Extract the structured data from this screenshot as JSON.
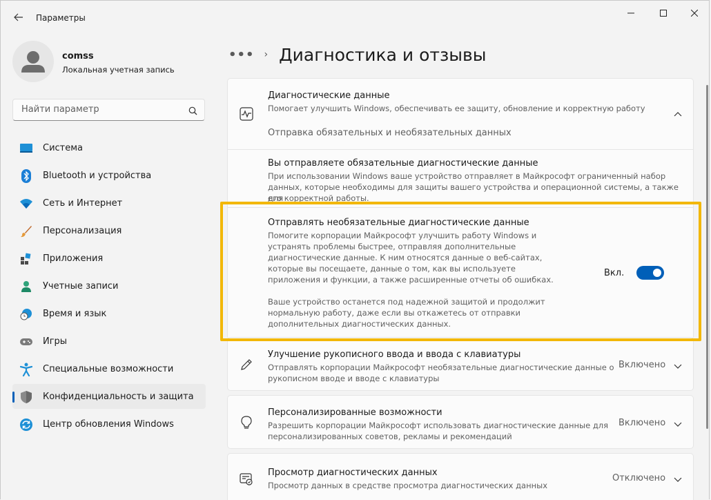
{
  "app": {
    "title": "Параметры"
  },
  "window_controls": {
    "minimize": "—",
    "maximize": "☐",
    "close": "✕"
  },
  "profile": {
    "name": "comss",
    "account_type": "Локальная учетная запись"
  },
  "search": {
    "placeholder": "Найти параметр"
  },
  "nav": {
    "items": [
      {
        "label": "Система",
        "icon": "system-icon",
        "active": false
      },
      {
        "label": "Bluetooth и устройства",
        "icon": "bluetooth-icon",
        "active": false
      },
      {
        "label": "Сеть и Интернет",
        "icon": "wifi-icon",
        "active": false
      },
      {
        "label": "Персонализация",
        "icon": "brush-icon",
        "active": false
      },
      {
        "label": "Приложения",
        "icon": "apps-icon",
        "active": false
      },
      {
        "label": "Учетные записи",
        "icon": "account-icon",
        "active": false
      },
      {
        "label": "Время и язык",
        "icon": "clock-globe-icon",
        "active": false
      },
      {
        "label": "Игры",
        "icon": "gamepad-icon",
        "active": false
      },
      {
        "label": "Специальные возможности",
        "icon": "accessibility-icon",
        "active": false
      },
      {
        "label": "Конфиденциальность и защита",
        "icon": "shield-icon",
        "active": true
      },
      {
        "label": "Центр обновления Windows",
        "icon": "update-icon",
        "active": false
      }
    ]
  },
  "breadcrumb": {
    "overflow": "•••",
    "separator": "›",
    "page_title": "Диагностика и отзывы"
  },
  "diagnostic_data": {
    "title": "Диагностические данные",
    "description": "Помогает улучшить Windows, обеспечивать ее защиту, обновление и корректную работу",
    "summary": "Отправка обязательных и необязательных данных",
    "required": {
      "title": "Вы отправляете обязательные диагностические данные",
      "description_lines": [
        "При использовании Windows ваше устройство отправляет в Майкрософт ограниченный набор",
        "данных, которые необходимы для защиты вашего устройства и операционной системы, а также для",
        "его корректной работы."
      ]
    },
    "optional": {
      "title": "Отправлять необязательные диагностические данные",
      "description_lines": [
        "Помогите корпорации Майкрософт улучшить работу Windows и",
        "устранять проблемы быстрее, отправляя дополнительные",
        "диагностические данные. К ним относятся данные о веб-сайтах,",
        "которые вы посещаете, данные о том, как вы используете",
        "приложения и функции, а также расширенные отчеты об ошибках."
      ],
      "note_lines": [
        "Ваше устройство останется под надежной защитой и продолжит",
        "нормальную работу, даже если вы откажетесь от отправки",
        "дополнительных диагностических данных."
      ],
      "toggle_label": "Вкл.",
      "toggle_on": true
    }
  },
  "handwriting": {
    "title": "Улучшение рукописного ввода и ввода с клавиатуры",
    "description_lines": [
      "Отправлять корпорации Майкрософт необязательные диагностические данные о",
      "рукописном вводе и вводе с клавиатуры"
    ],
    "status": "Включено"
  },
  "tailored": {
    "title": "Персонализированные возможности",
    "description_lines": [
      "Разрешить корпорации Майкрософт использовать диагностические данные для",
      "персонализированных советов, рекламы и рекомендаций"
    ],
    "status": "Включено"
  },
  "viewer": {
    "title": "Просмотр диагностических данных",
    "description_lines": [
      "Просмотр данных в средстве просмотра диагностических данных"
    ],
    "status": "Отключено"
  },
  "colors": {
    "accent": "#005fb8",
    "highlight": "#f2b705"
  }
}
